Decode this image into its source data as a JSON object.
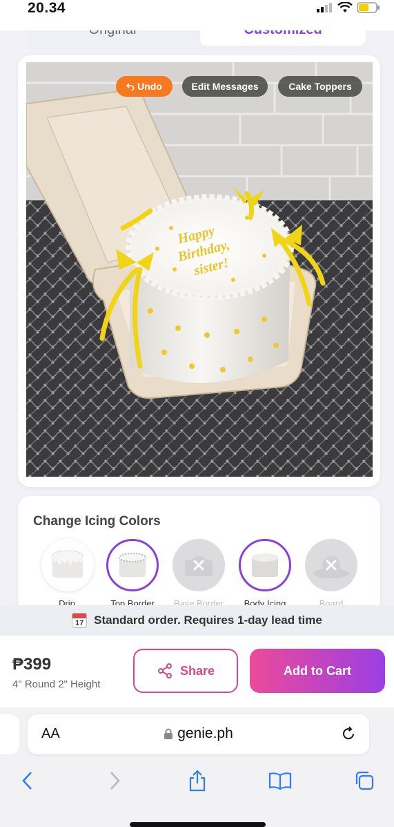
{
  "status_bar": {
    "time": "20.34"
  },
  "view_toggle": {
    "left_label": "Original",
    "right_label": "Customized"
  },
  "image_actions": {
    "undo": "Undo",
    "edit_messages": "Edit Messages",
    "cake_toppers": "Cake Toppers"
  },
  "cake_message": "Happy Birthday, sister!",
  "icing": {
    "title": "Change Icing Colors",
    "options": [
      {
        "label": "Drip",
        "state": "available"
      },
      {
        "label": "Top Border",
        "state": "selected"
      },
      {
        "label": "Base Border",
        "state": "disabled"
      },
      {
        "label": "Body Icing",
        "state": "selected"
      },
      {
        "label": "Board",
        "state": "disabled"
      }
    ]
  },
  "lead_time": {
    "calendar_day": "17",
    "text": "Standard order. Requires 1-day lead time"
  },
  "cart": {
    "price": "₱399",
    "size": "4\" Round 2\" Height",
    "share_label": "Share",
    "add_label": "Add to Cart"
  },
  "browser": {
    "text_size": "AA",
    "domain": "genie.ph"
  },
  "colors": {
    "accent_orange": "#f47920",
    "accent_purple": "#8b3fd9",
    "accent_pink": "#e0457f",
    "icing_yellow": "#f2d416"
  }
}
